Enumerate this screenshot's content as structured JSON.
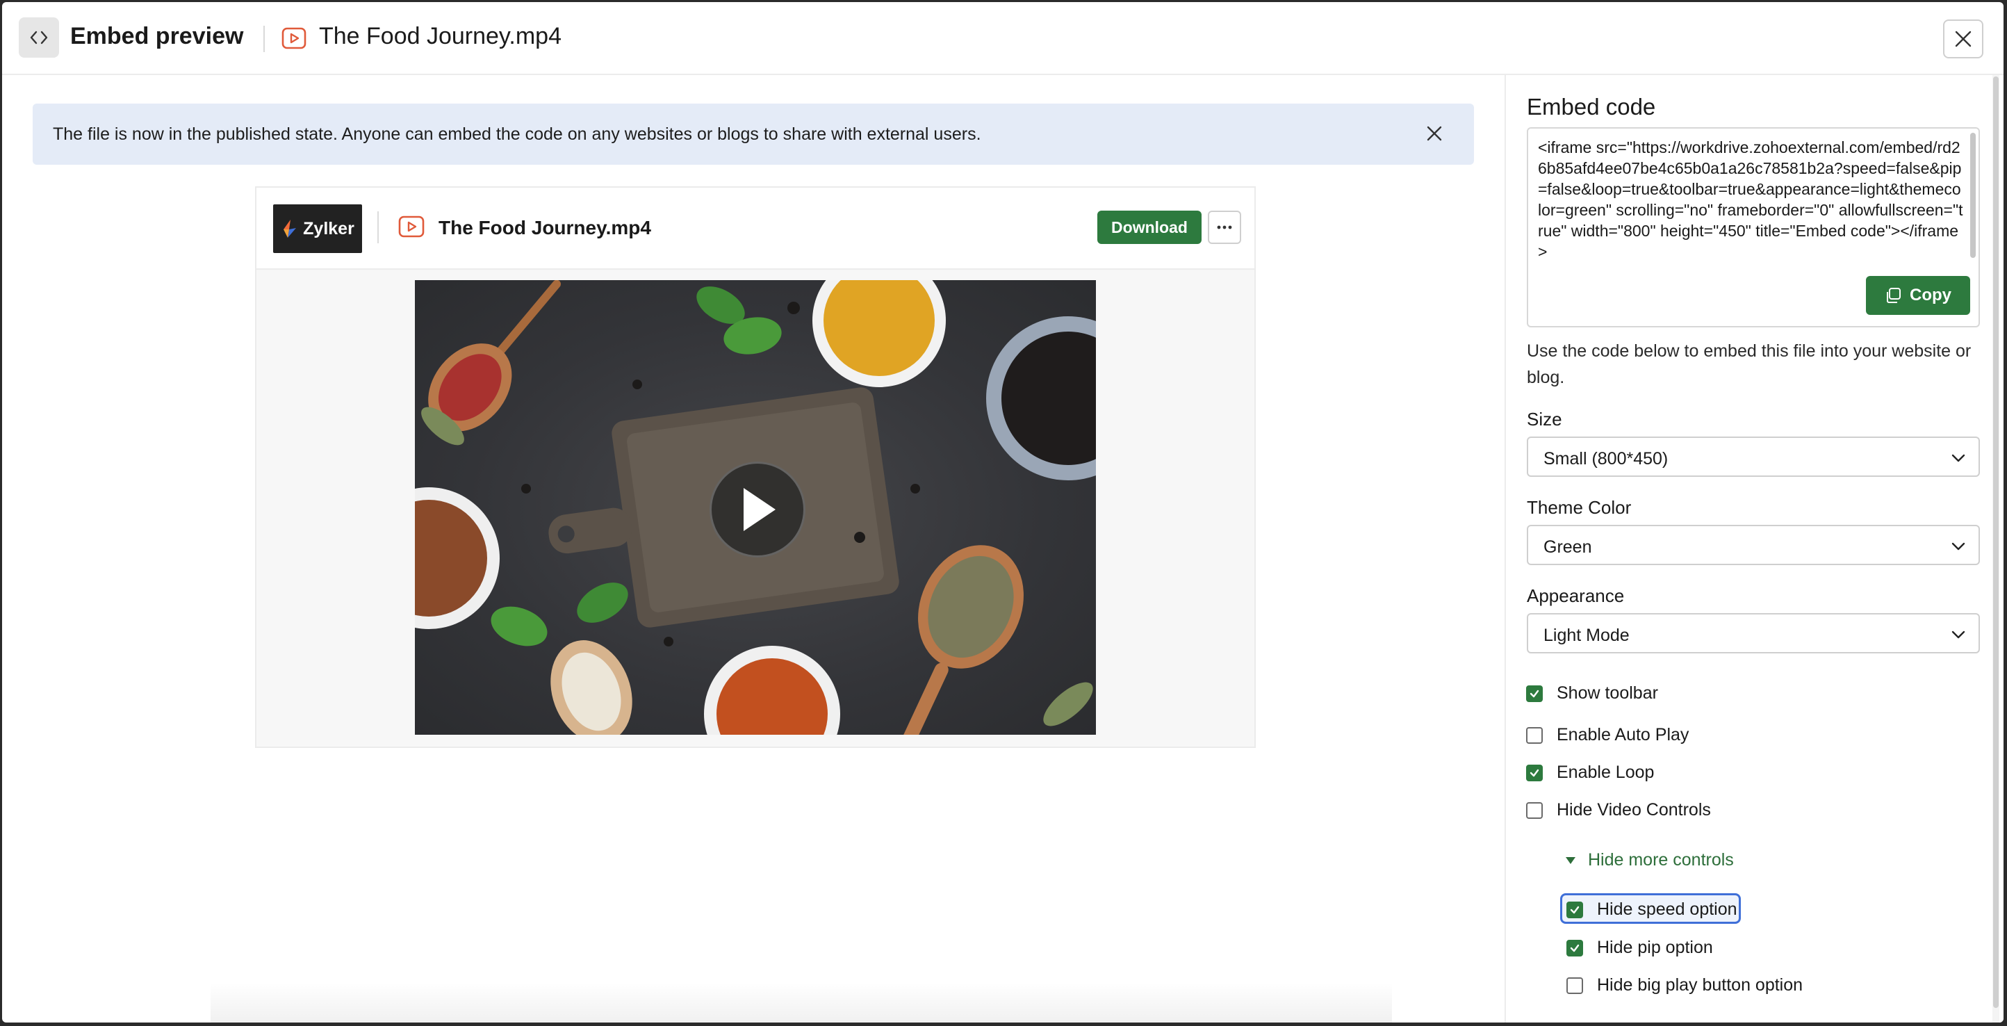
{
  "header": {
    "title": "Embed preview",
    "filename": "The Food Journey.mp4",
    "icons": [
      "code-icon",
      "video-file-icon",
      "close-icon"
    ]
  },
  "banner": {
    "text": "The file is now in the published state. Anyone can embed the code on any websites or blogs to share with external users."
  },
  "preview": {
    "logo_text": "Zylker",
    "filename": "The Food Journey.mp4",
    "download_label": "Download",
    "more_label": "···"
  },
  "panel": {
    "heading": "Embed code",
    "code": "<iframe src=\"https://workdrive.zohoexternal.com/embed/rd26b85afd4ee07be4c65b0a1a26c78581b2a?speed=false&pip=false&loop=true&toolbar=true&appearance=light&themecolor=green\" scrolling=\"no\" frameborder=\"0\" allowfullscreen=\"true\" width=\"800\" height=\"450\" title=\"Embed code\"></iframe>",
    "copy_label": "Copy",
    "helper": "Use the code below to embed this file into your website or blog.",
    "size": {
      "label": "Size",
      "value": "Small (800*450)"
    },
    "theme": {
      "label": "Theme Color",
      "value": "Green"
    },
    "appearance": {
      "label": "Appearance",
      "value": "Light Mode"
    },
    "options": {
      "show_toolbar": {
        "label": "Show toolbar",
        "checked": true
      },
      "auto_play": {
        "label": "Enable Auto Play",
        "checked": false
      },
      "loop": {
        "label": "Enable Loop",
        "checked": true
      },
      "hide_controls": {
        "label": "Hide Video Controls",
        "checked": false
      }
    },
    "more_controls_label": "Hide more controls",
    "sub_options": {
      "hide_speed": {
        "label": "Hide speed option",
        "checked": true
      },
      "hide_pip": {
        "label": "Hide pip option",
        "checked": true
      },
      "hide_big_play": {
        "label": "Hide big play button option",
        "checked": false
      }
    }
  },
  "colors": {
    "accent": "#2d7a3e",
    "banner": "#e4ebf7",
    "focus": "#3f6fd8"
  }
}
